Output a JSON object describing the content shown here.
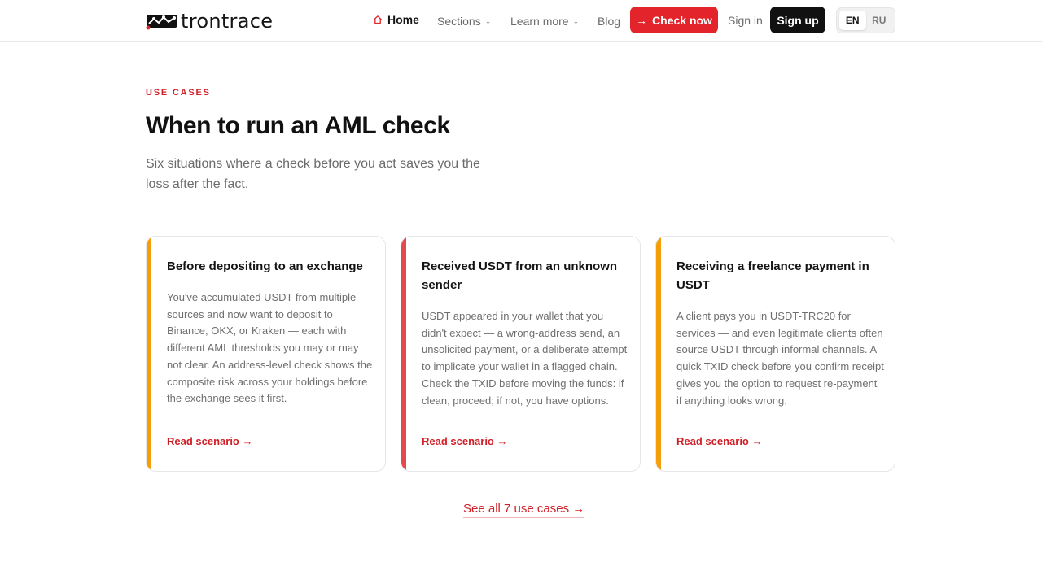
{
  "header": {
    "logo_text": "trontrace",
    "nav": {
      "home": "Home",
      "sections": "Sections",
      "learn_more": "Learn more",
      "blog": "Blog"
    },
    "check_now": "Check now",
    "sign_in": "Sign in",
    "sign_up": "Sign up",
    "languages": [
      "EN",
      "RU"
    ],
    "active_language": "EN"
  },
  "section": {
    "eyebrow": "USE CASES",
    "title": "When to run an AML check",
    "subtitle": "Six situations where a check before you act saves you the loss after the fact."
  },
  "cards": [
    {
      "title": "Before depositing to an exchange",
      "body": "You've accumulated USDT from multiple sources and now want to deposit to Binance, OKX, or Kraken — each with different AML thresholds you may or may not clear. An address-level check shows the composite risk across your holdings before the exchange sees it first.",
      "link": "Read scenario →",
      "accent": "#f59e0b"
    },
    {
      "title": "Received USDT from an unknown sender",
      "body": "USDT appeared in your wallet that you didn't expect — a wrong-address send, an unsolicited payment, or a deliberate attempt to implicate your wallet in a flagged chain. Check the TXID before moving the funds: if clean, proceed; if not, you have options.",
      "link": "Read scenario →",
      "accent": "#e5484d"
    },
    {
      "title": "Receiving a freelance payment in USDT",
      "body": "A client pays you in USDT-TRC20 for services — and even legitimate clients often source USDT through informal channels. A quick TXID check before you confirm receipt gives you the option to request re-payment if anything looks wrong.",
      "link": "Read scenario →",
      "accent": "#f59e0b"
    }
  ],
  "see_all": "See all 7 use cases →",
  "colors": {
    "brand_red": "#e3242b",
    "link_red": "#d11f27",
    "dark": "#111111"
  }
}
